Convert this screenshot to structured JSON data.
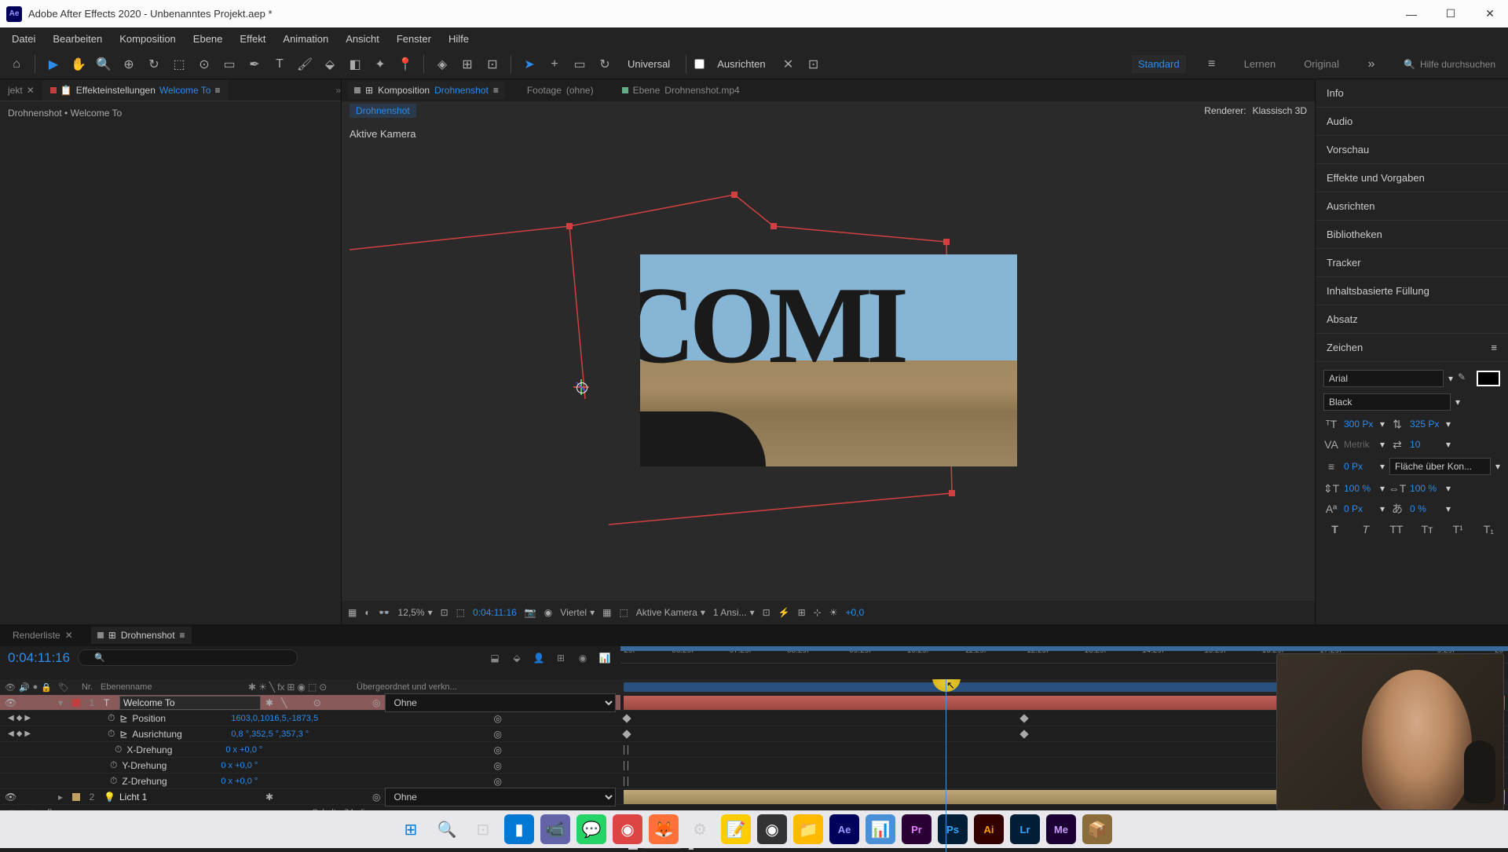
{
  "titlebar": {
    "title": "Adobe After Effects 2020 - Unbenanntes Projekt.aep *"
  },
  "menu": [
    "Datei",
    "Bearbeiten",
    "Komposition",
    "Ebene",
    "Effekt",
    "Animation",
    "Ansicht",
    "Fenster",
    "Hilfe"
  ],
  "toolbar": {
    "universal": "Universal",
    "ausrichten": "Ausrichten"
  },
  "workspaces": [
    "Standard",
    "Lernen",
    "Original"
  ],
  "search_placeholder": "Hilfe durchsuchen",
  "left_panel": {
    "tab_project": "jekt",
    "tab_effects": "Effekteinstellungen",
    "tab_effects_target": "Welcome To",
    "breadcrumb": "Drohnenshot • Welcome To"
  },
  "center": {
    "tab_comp": "Komposition",
    "tab_comp_target": "Drohnenshot",
    "tab_footage": "Footage",
    "tab_footage_val": "(ohne)",
    "tab_layer": "Ebene",
    "tab_layer_val": "Drohnenshot.mp4",
    "bread": "Drohnenshot",
    "renderer_label": "Renderer:",
    "renderer_val": "Klassisch 3D",
    "active_cam": "Aktive Kamera",
    "comi": "COMI"
  },
  "viewer_footer": {
    "zoom": "12,5%",
    "time": "0:04:11:16",
    "res": "Viertel",
    "camera": "Aktive Kamera",
    "views": "1 Ansi...",
    "exposure": "+0,0"
  },
  "right_panels": [
    "Info",
    "Audio",
    "Vorschau",
    "Effekte und Vorgaben",
    "Ausrichten",
    "Bibliotheken",
    "Tracker",
    "Inhaltsbasierte Füllung",
    "Absatz"
  ],
  "char": {
    "title": "Zeichen",
    "font": "Arial",
    "weight": "Black",
    "size": "300",
    "size_unit": "Px",
    "leading": "325",
    "leading_unit": "Px",
    "kerning": "Metrik",
    "tracking": "10",
    "stroke": "0",
    "stroke_unit": "Px",
    "stroke_mode": "Fläche über Kon...",
    "vscale": "100",
    "vscale_unit": "%",
    "hscale": "100",
    "hscale_unit": "%",
    "baseline": "0",
    "baseline_unit": "Px",
    "tsume": "0",
    "tsume_unit": "%"
  },
  "timeline": {
    "tab_render": "Renderliste",
    "tab_comp": "Drohnenshot",
    "timecode": "0:04:11:16",
    "cols": {
      "nr": "Nr.",
      "name": "Ebenenname",
      "parent": "Übergeordnet und verkn..."
    },
    "ruler": [
      "29f",
      "06:29f",
      "07:29f",
      "08:29f",
      "09:29f",
      "10:29f",
      "11:29f",
      "12:29f",
      "13:29f",
      "14:29f",
      "15:29f",
      "16:29f",
      "17:29f",
      "",
      "9:29f",
      "20"
    ],
    "layers": [
      {
        "num": "1",
        "name": "Welcome To",
        "parent": "Ohne",
        "type": "text"
      },
      {
        "num": "2",
        "name": "Licht 1",
        "parent": "Ohne",
        "type": "light"
      }
    ],
    "props": [
      {
        "name": "Position",
        "val": "1603,0,1016,5,-1873,5"
      },
      {
        "name": "Ausrichtung",
        "val": "0,8 °,352,5 °,357,3 °"
      },
      {
        "name": "X-Drehung",
        "val": "0 x +0,0 °"
      },
      {
        "name": "Y-Drehung",
        "val": "0 x +0,0 °"
      },
      {
        "name": "Z-Drehung",
        "val": "0 x +0,0 °"
      }
    ],
    "footer": "Schalter/Modi"
  }
}
